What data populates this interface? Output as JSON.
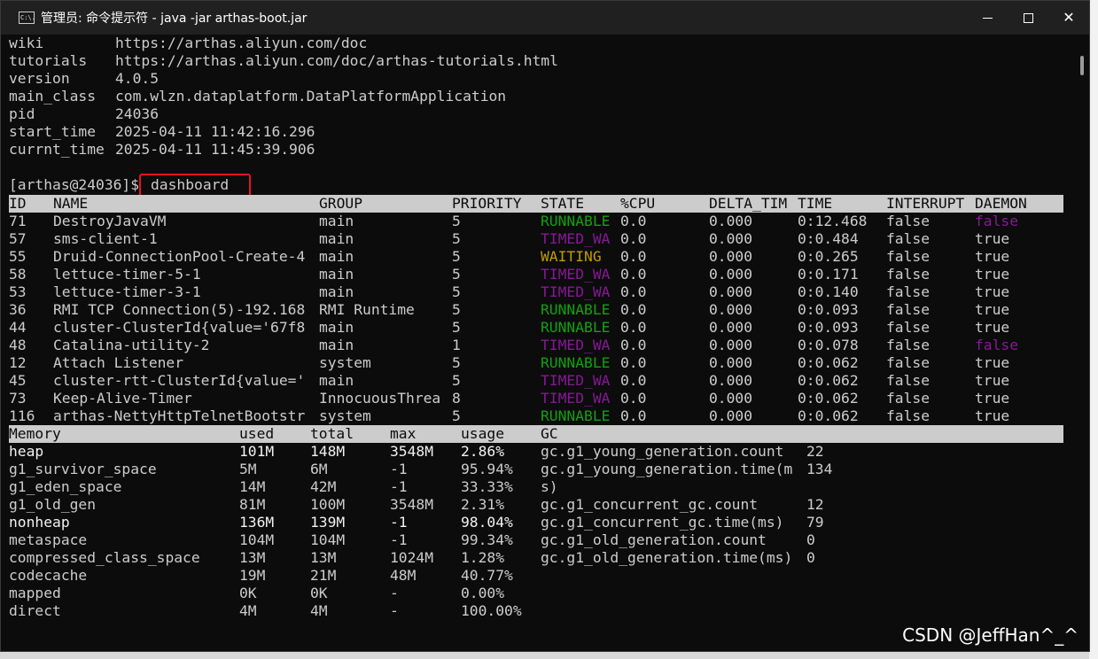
{
  "window": {
    "title": "管理员: 命令提示符 - java  -jar arthas-boot.jar",
    "icon_text": "C:\\."
  },
  "info": [
    {
      "key": "wiki",
      "value": "https://arthas.aliyun.com/doc"
    },
    {
      "key": "tutorials",
      "value": "https://arthas.aliyun.com/doc/arthas-tutorials.html"
    },
    {
      "key": "version",
      "value": "4.0.5"
    },
    {
      "key": "main_class",
      "value": "com.wlzn.dataplatform.DataPlatformApplication"
    },
    {
      "key": "pid",
      "value": "24036"
    },
    {
      "key": "start_time",
      "value": "2025-04-11 11:42:16.296"
    },
    {
      "key": "currnt_time",
      "value": "2025-04-11 11:45:39.906"
    }
  ],
  "prompt": {
    "text": "[arthas@24036]$",
    "command": "dashboard"
  },
  "thread_headers": [
    "ID",
    "NAME",
    "GROUP",
    "PRIORITY",
    "STATE",
    "%CPU",
    "DELTA_TIM",
    "TIME",
    "INTERRUPT",
    "DAEMON"
  ],
  "threads": [
    [
      "71",
      "DestroyJavaVM",
      "main",
      "5",
      "RUNNABLE",
      "0.0",
      "0.000",
      "0:12.468",
      "false",
      "false"
    ],
    [
      "57",
      "sms-client-1",
      "main",
      "5",
      "TIMED_WA",
      "0.0",
      "0.000",
      "0:0.484",
      "false",
      "true"
    ],
    [
      "55",
      "Druid-ConnectionPool-Create-4",
      "main",
      "5",
      "WAITING",
      "0.0",
      "0.000",
      "0:0.265",
      "false",
      "true"
    ],
    [
      "58",
      "lettuce-timer-5-1",
      "main",
      "5",
      "TIMED_WA",
      "0.0",
      "0.000",
      "0:0.171",
      "false",
      "true"
    ],
    [
      "53",
      "lettuce-timer-3-1",
      "main",
      "5",
      "TIMED_WA",
      "0.0",
      "0.000",
      "0:0.140",
      "false",
      "true"
    ],
    [
      "36",
      "RMI TCP Connection(5)-192.168",
      "RMI Runtime",
      "5",
      "RUNNABLE",
      "0.0",
      "0.000",
      "0:0.093",
      "false",
      "true"
    ],
    [
      "44",
      "cluster-ClusterId{value='67f8",
      "main",
      "5",
      "RUNNABLE",
      "0.0",
      "0.000",
      "0:0.093",
      "false",
      "true"
    ],
    [
      "48",
      "Catalina-utility-2",
      "main",
      "1",
      "TIMED_WA",
      "0.0",
      "0.000",
      "0:0.078",
      "false",
      "false"
    ],
    [
      "12",
      "Attach Listener",
      "system",
      "5",
      "RUNNABLE",
      "0.0",
      "0.000",
      "0:0.062",
      "false",
      "true"
    ],
    [
      "45",
      "cluster-rtt-ClusterId{value='",
      "main",
      "5",
      "TIMED_WA",
      "0.0",
      "0.000",
      "0:0.062",
      "false",
      "true"
    ],
    [
      "73",
      "Keep-Alive-Timer",
      "InnocuousThrea",
      "8",
      "TIMED_WA",
      "0.0",
      "0.000",
      "0:0.062",
      "false",
      "true"
    ],
    [
      "116",
      "arthas-NettyHttpTelnetBootstr",
      "system",
      "5",
      "RUNNABLE",
      "0.0",
      "0.000",
      "0:0.062",
      "false",
      "true"
    ]
  ],
  "memory_headers": [
    "Memory",
    "used",
    "total",
    "max",
    "usage",
    "GC"
  ],
  "memory": [
    [
      "heap",
      "101M",
      "148M",
      "3548M",
      "2.86%"
    ],
    [
      "g1_survivor_space",
      "5M",
      "6M",
      "-1",
      "95.94%"
    ],
    [
      "g1_eden_space",
      "14M",
      "42M",
      "-1",
      "33.33%"
    ],
    [
      "g1_old_gen",
      "81M",
      "100M",
      "3548M",
      "2.31%"
    ],
    [
      "nonheap",
      "136M",
      "139M",
      "-1",
      "98.04%"
    ],
    [
      "metaspace",
      "104M",
      "104M",
      "-1",
      "99.34%"
    ],
    [
      "compressed_class_space",
      "13M",
      "13M",
      "1024M",
      "1.28%"
    ],
    [
      "codecache",
      "19M",
      "21M",
      "48M",
      "40.77%"
    ],
    [
      "mapped",
      "0K",
      "0K",
      "-",
      "0.00%"
    ],
    [
      "direct",
      "4M",
      "4M",
      "-",
      "100.00%"
    ]
  ],
  "gc": [
    [
      "gc.g1_young_generation.count",
      "22"
    ],
    [
      "gc.g1_young_generation.time(m",
      "134"
    ],
    [
      "s)",
      ""
    ],
    [
      "gc.g1_concurrent_gc.count",
      "12"
    ],
    [
      "gc.g1_concurrent_gc.time(ms)",
      "79"
    ],
    [
      "gc.g1_old_generation.count",
      "0"
    ],
    [
      "gc.g1_old_generation.time(ms)",
      "0"
    ]
  ],
  "watermark": "CSDN @JeffHan^_^",
  "colors": {
    "runnable": "#13a10e",
    "timed": "#881798",
    "waiting": "#c19c00",
    "highlight": "#e81123"
  }
}
